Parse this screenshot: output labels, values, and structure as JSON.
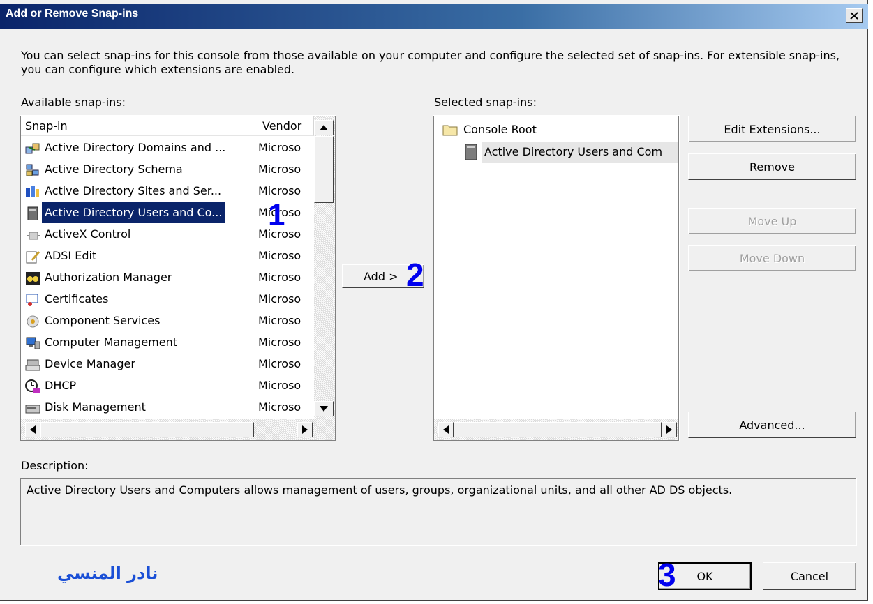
{
  "window": {
    "title": "Add or Remove Snap-ins",
    "close_glyph": "✕"
  },
  "intro_text": "You can select snap-ins for this console from those available on your computer and configure the selected set of snap-ins. For extensible snap-ins, you can configure which extensions are enabled.",
  "available": {
    "label": "Available snap-ins:",
    "columns": {
      "snapin": "Snap-in",
      "vendor": "Vendor"
    },
    "items": [
      {
        "name": "Active Directory Domains and ...",
        "vendor": "Microso",
        "icon": "domains-trusts-icon"
      },
      {
        "name": "Active Directory Schema",
        "vendor": "Microso",
        "icon": "schema-icon"
      },
      {
        "name": "Active Directory Sites and Ser...",
        "vendor": "Microso",
        "icon": "sites-services-icon"
      },
      {
        "name": "Active Directory Users and Co...",
        "vendor": "Microso",
        "icon": "users-computers-icon"
      },
      {
        "name": "ActiveX Control",
        "vendor": "Microso",
        "icon": "activex-icon"
      },
      {
        "name": "ADSI Edit",
        "vendor": "Microso",
        "icon": "adsi-edit-icon"
      },
      {
        "name": "Authorization Manager",
        "vendor": "Microso",
        "icon": "authorization-manager-icon"
      },
      {
        "name": "Certificates",
        "vendor": "Microso",
        "icon": "certificates-icon"
      },
      {
        "name": "Component Services",
        "vendor": "Microso",
        "icon": "component-services-icon"
      },
      {
        "name": "Computer Management",
        "vendor": "Microso",
        "icon": "computer-management-icon"
      },
      {
        "name": "Device Manager",
        "vendor": "Microso",
        "icon": "device-manager-icon"
      },
      {
        "name": "DHCP",
        "vendor": "Microso",
        "icon": "dhcp-icon"
      },
      {
        "name": "Disk Management",
        "vendor": "Microso",
        "icon": "disk-management-icon"
      }
    ]
  },
  "add_button": "Add >",
  "selected": {
    "label": "Selected snap-ins:",
    "root": "Console Root",
    "child": "Active Directory Users and Com"
  },
  "buttons": {
    "edit_extensions": "Edit Extensions...",
    "remove": "Remove",
    "move_up": "Move Up",
    "move_down": "Move Down",
    "advanced": "Advanced...",
    "ok": "OK",
    "cancel": "Cancel"
  },
  "description": {
    "label": "Description:",
    "text": "Active Directory Users and Computers allows management of users, groups, organizational units, and all other AD DS objects."
  },
  "annotations": {
    "step1": "1",
    "step2": "2",
    "step3": "3"
  },
  "signature": "نادر المنسي",
  "colors": {
    "title_start": "#0a246a",
    "selection": "#0a246a",
    "annotation": "#0000ee"
  }
}
